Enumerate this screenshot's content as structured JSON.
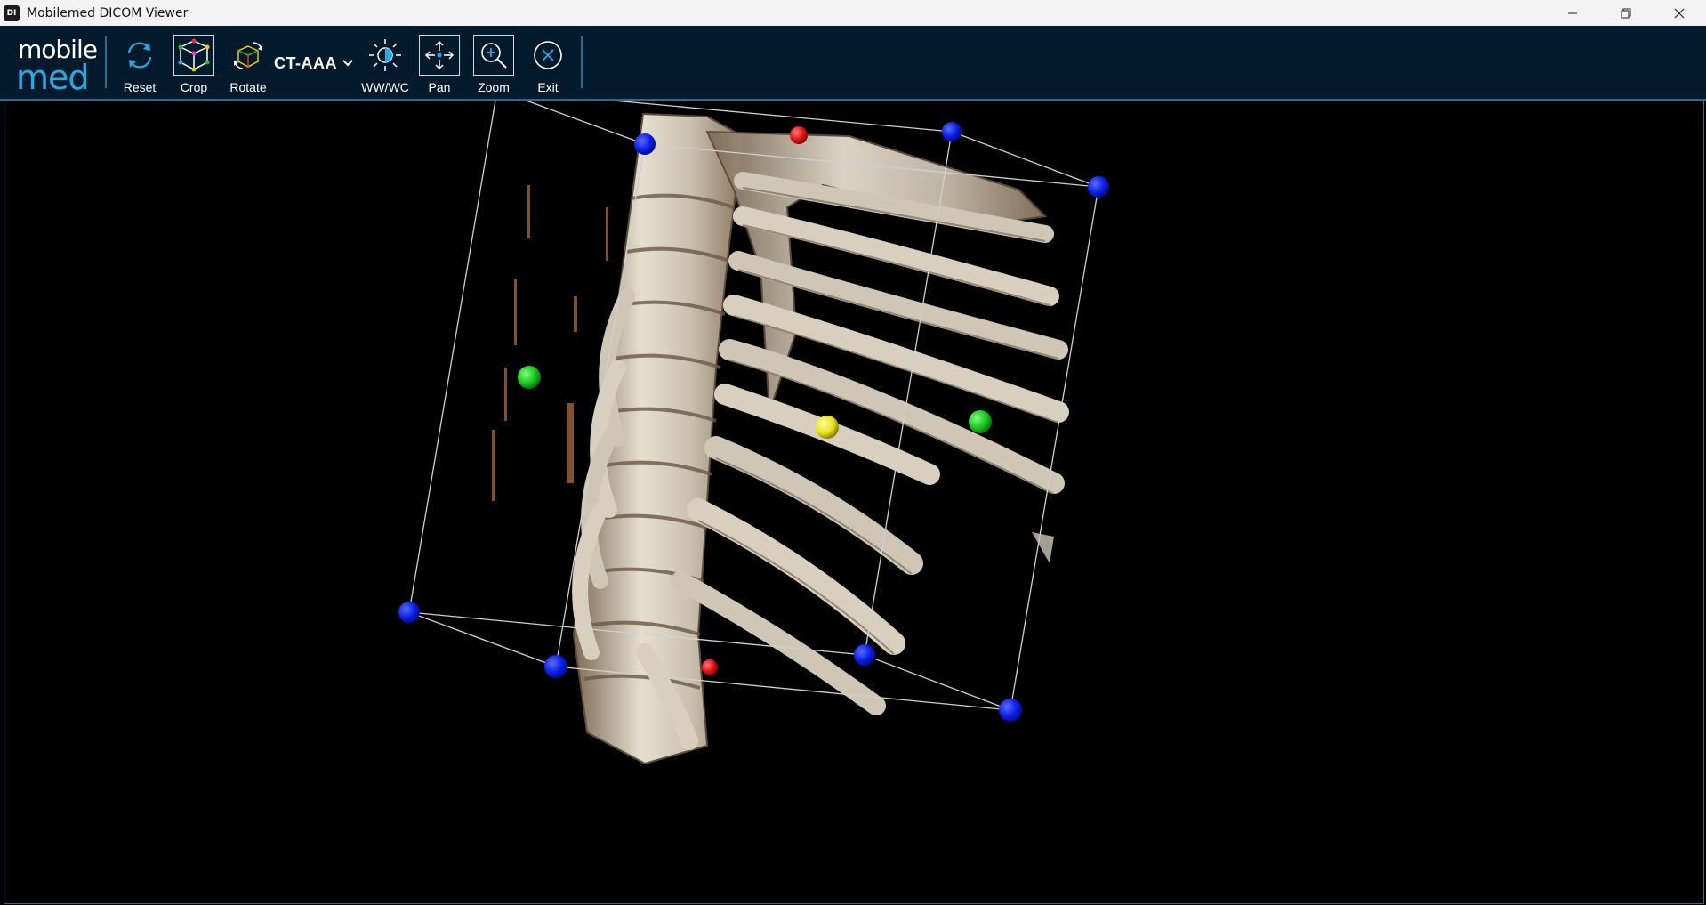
{
  "window": {
    "title": "Mobilemed DICOM Viewer",
    "app_icon": "dicom-app-icon",
    "controls": [
      "minimize-icon",
      "restore-icon",
      "close-icon"
    ]
  },
  "logo": {
    "line1": "mobile",
    "line2": "med"
  },
  "toolbar": {
    "reset_label": "Reset",
    "crop_label": "Crop",
    "rotate_label": "Rotate",
    "preset_value": "CT-AAA",
    "wwwc_label": "WW/WC",
    "pan_label": "Pan",
    "zoom_label": "Zoom",
    "exit_label": "Exit"
  },
  "colors": {
    "toolbar_bg": "#031a2c",
    "accent": "#29a9e1",
    "bone": "#d9d2c2",
    "corner_handle": "#0a1ee6",
    "face_handle_green": "#19c41f",
    "face_handle_red": "#e01010",
    "center_handle_yellow": "#e6e21a"
  },
  "viewport": {
    "content": "3D volume rendering of thoracic spine and ribs inside a crop bounding box"
  }
}
